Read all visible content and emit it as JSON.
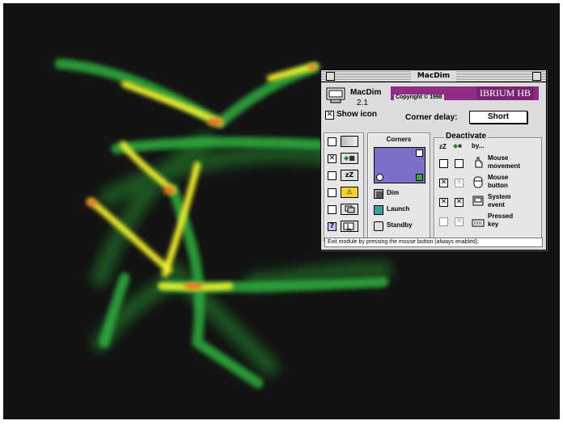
{
  "window": {
    "title": "MacDim"
  },
  "app": {
    "name": "MacDim",
    "version": "2.1",
    "show_icon_label": "Show icon",
    "copyright": "Copyright © 1998",
    "banner": "IBRIUM HB"
  },
  "corner_delay": {
    "label": "Corner delay:",
    "value": "Short"
  },
  "side_tiles": {
    "sleep": "zZ",
    "badge": "⚠"
  },
  "corners": {
    "title": "Corners",
    "dim": "Dim",
    "launch": "Launch",
    "standby": "Standby"
  },
  "deactivate": {
    "title": "Deactivate",
    "sleep_icon": "zZ",
    "by": "by...",
    "rows": [
      {
        "line1": "Mouse",
        "line2": "movement"
      },
      {
        "line1": "Mouse",
        "line2": "button"
      },
      {
        "line1": "System",
        "line2": "event"
      },
      {
        "line1": "Pressed",
        "line2": "key"
      }
    ]
  },
  "status": "Exit module by pressing the mouse button (always enabled).",
  "help_label": "?",
  "colors": {
    "screen": "#131313",
    "banner": "#8e2c86",
    "corner_preview": "#7a70c8",
    "glow_green": "#2fae3c",
    "glow_yellow": "#f1ef2c",
    "glow_orange": "#e4702a"
  }
}
